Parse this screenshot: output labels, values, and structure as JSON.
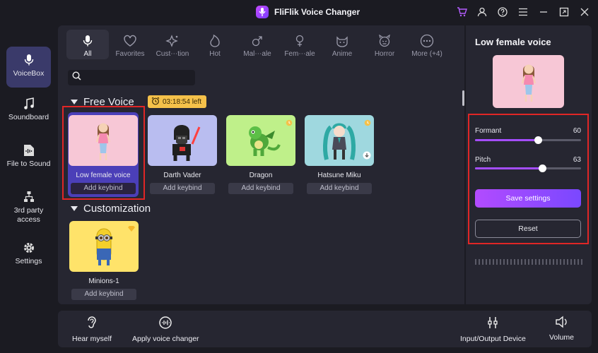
{
  "app": {
    "title": "FliFlik Voice Changer"
  },
  "sidebar": {
    "items": [
      {
        "label": "VoiceBox",
        "icon": "microphone-icon",
        "active": true
      },
      {
        "label": "Soundboard",
        "icon": "music-note-icon"
      },
      {
        "label": "File to Sound",
        "icon": "file-audio-icon"
      },
      {
        "label": "3rd party access",
        "icon": "network-icon"
      },
      {
        "label": "Settings",
        "icon": "gear-icon"
      }
    ]
  },
  "tabs": [
    {
      "label": "All",
      "icon": "microphone-icon",
      "active": true
    },
    {
      "label": "Favorites",
      "icon": "heart-icon"
    },
    {
      "label": "Cust⋯tion",
      "icon": "sparkle-icon"
    },
    {
      "label": "Hot",
      "icon": "flame-icon"
    },
    {
      "label": "Mal⋯ale",
      "icon": "male-icon"
    },
    {
      "label": "Fem⋯ale",
      "icon": "female-icon"
    },
    {
      "label": "Anime",
      "icon": "cat-face-icon"
    },
    {
      "label": "Horror",
      "icon": "devil-face-icon"
    },
    {
      "label": "More (+4)",
      "icon": "more-dots-icon"
    }
  ],
  "search": {
    "placeholder": "",
    "value": ""
  },
  "free_voice": {
    "title": "Free Voice",
    "timer": "03:18:54 left",
    "cards": [
      {
        "name": "Low female voice",
        "keybind": "Add keybind",
        "color": "#f7c7d6"
      },
      {
        "name": "Darth Vader",
        "keybind": "Add keybind",
        "color": "#b9bdf0"
      },
      {
        "name": "Dragon",
        "keybind": "Add keybind",
        "color": "#bff08a",
        "badge": "clock-icon"
      },
      {
        "name": "Hatsune Miku",
        "keybind": "Add keybind",
        "color": "#9fd8df",
        "badge": "clock-icon"
      }
    ]
  },
  "customization": {
    "title": "Customization",
    "cards": [
      {
        "name": "Minions-1",
        "keybind": "Add keybind",
        "color": "#ffe36a",
        "badge": "diamond-icon"
      }
    ]
  },
  "settings_panel": {
    "title": "Low female voice",
    "formant": {
      "label": "Formant",
      "value": "60",
      "fraction": 0.59
    },
    "pitch": {
      "label": "Pitch",
      "value": "63",
      "fraction": 0.63
    },
    "save_label": "Save settings",
    "reset_label": "Reset"
  },
  "bottom_bar": {
    "hear_myself": "Hear myself",
    "apply_changer": "Apply voice changer",
    "io_device": "Input/Output Device",
    "volume": "Volume"
  },
  "colors": {
    "accent": "#a44dff",
    "highlight": "#e02626",
    "timer": "#f5c14a"
  }
}
